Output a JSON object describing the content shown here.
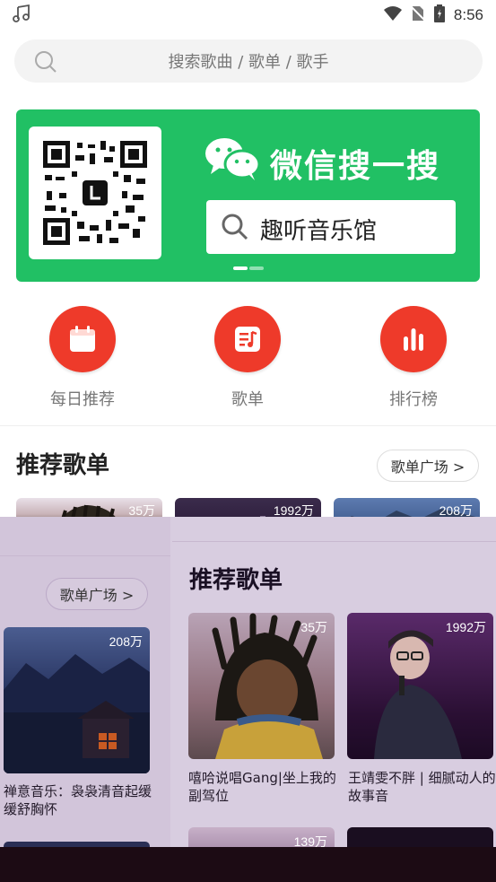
{
  "status_bar": {
    "time": "8:56",
    "icons": [
      "music-note-icon",
      "wifi-icon",
      "no-sim-icon",
      "battery-icon"
    ]
  },
  "search": {
    "placeholder": "搜索歌曲 / 歌单 / 歌手"
  },
  "banner": {
    "title": "微信搜一搜",
    "search_text": "趣听音乐馆",
    "bg_color": "#21c064"
  },
  "quick_entries": [
    {
      "label": "每日推荐",
      "icon": "calendar-icon"
    },
    {
      "label": "歌单",
      "icon": "playlist-icon"
    },
    {
      "label": "排行榜",
      "icon": "ranking-icon"
    }
  ],
  "section": {
    "title": "推荐歌单",
    "more_label": "歌单广场 >"
  },
  "playlists_top": [
    {
      "count": "35万"
    },
    {
      "count": "1992万"
    },
    {
      "count": "208万"
    }
  ],
  "overlay": {
    "title": "推荐歌单",
    "more_label": "歌单广场 >",
    "left_card": {
      "count": "208万",
      "title": "禅意音乐：袅袅清音起缓缓舒胸怀"
    },
    "cards": [
      {
        "count": "35万",
        "title": "嘻哈说唱Gang|坐上我的副驾位"
      },
      {
        "count": "1992万",
        "title": "王靖雯不胖 | 细腻动人的故事音"
      },
      {
        "count": "139万",
        "title": ""
      }
    ]
  },
  "accent_color": "#ee3a2a"
}
